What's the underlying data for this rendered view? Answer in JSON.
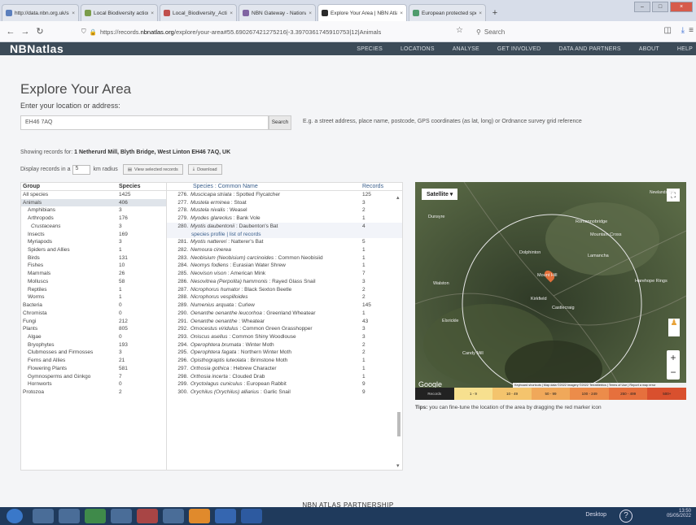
{
  "browser": {
    "tabs": [
      {
        "label": "http://data.nbn.org.uk/sites/r",
        "color": "#5b7fbd"
      },
      {
        "label": "Local Biodiversity action plan |",
        "color": "#7a9c4a"
      },
      {
        "label": "Local_Biodiversity_Action_Plan_2",
        "color": "#c0504d"
      },
      {
        "label": "NBN Gateway - National Biodi",
        "color": "#8064a2"
      },
      {
        "label": "Explore Your Area | NBN Atlas",
        "color": "#2b2b2b"
      },
      {
        "label": "European protected species | N",
        "color": "#4f9c6d"
      }
    ],
    "url_prefix": "https://records.",
    "url_domain": "nbnatlas.org",
    "url_rest": "/explore/your-area#55.690267421275216|-3.3970361745910753|12|Animals",
    "search_placeholder": "Search"
  },
  "site": {
    "logo": "NBNatlas",
    "nav": [
      "SPECIES",
      "LOCATIONS",
      "ANALYSE",
      "GET INVOLVED",
      "DATA AND PARTNERS",
      "ABOUT",
      "HELP"
    ],
    "page_title": "Explore Your Area",
    "location_prompt": "Enter your location or address:",
    "location_value": "EH46 7AQ",
    "search_button": "Search",
    "hint": "E.g. a street address, place name, postcode, GPS coordinates (as lat, long) or Ordnance survey grid reference",
    "showing_prefix": "Showing records for:",
    "showing_place": "1 Netherurd Mill, Blyth Bridge, West Linton EH46 7AQ, UK",
    "display_prefix": "Display records in a",
    "radius": "5",
    "display_suffix": "km radius",
    "view_btn": "View selected records",
    "download_btn": "Download",
    "tips_bold": "Tips:",
    "tips_text": "you can fine-tune the location of the area by dragging the red marker icon",
    "partnership": "NBN ATLAS PARTNERSHIP"
  },
  "groups": {
    "headers": [
      "Group",
      "Species"
    ],
    "rows": [
      {
        "name": "All species",
        "count": "1425",
        "level": 0
      },
      {
        "name": "Animals",
        "count": "406",
        "level": 0,
        "selected": true
      },
      {
        "name": "Amphibians",
        "count": "3",
        "level": 1
      },
      {
        "name": "Arthropods",
        "count": "176",
        "level": 1
      },
      {
        "name": "Crustaceans",
        "count": "3",
        "level": 2
      },
      {
        "name": "Insects",
        "count": "169",
        "level": 1
      },
      {
        "name": "Myriapods",
        "count": "3",
        "level": 1
      },
      {
        "name": "Spiders and Allies",
        "count": "1",
        "level": 1
      },
      {
        "name": "Birds",
        "count": "131",
        "level": 1
      },
      {
        "name": "Fishes",
        "count": "10",
        "level": 1
      },
      {
        "name": "Mammals",
        "count": "26",
        "level": 1
      },
      {
        "name": "Molluscs",
        "count": "58",
        "level": 1
      },
      {
        "name": "Reptiles",
        "count": "1",
        "level": 1
      },
      {
        "name": "Worms",
        "count": "1",
        "level": 1
      },
      {
        "name": "Bacteria",
        "count": "0",
        "level": 0
      },
      {
        "name": "Chromista",
        "count": "0",
        "level": 0
      },
      {
        "name": "Fungi",
        "count": "212",
        "level": 0
      },
      {
        "name": "Plants",
        "count": "805",
        "level": 0
      },
      {
        "name": "Algae",
        "count": "0",
        "level": 1
      },
      {
        "name": "Bryophytes",
        "count": "193",
        "level": 1
      },
      {
        "name": "Clubmosses and Firmosses",
        "count": "3",
        "level": 1
      },
      {
        "name": "Ferns and Allies",
        "count": "21",
        "level": 1
      },
      {
        "name": "Flowering Plants",
        "count": "581",
        "level": 1
      },
      {
        "name": "Gymnosperms and Ginkgo",
        "count": "7",
        "level": 1
      },
      {
        "name": "Hornworts",
        "count": "0",
        "level": 1
      },
      {
        "name": "Protozoa",
        "count": "2",
        "level": 0
      }
    ]
  },
  "species": {
    "headers": [
      "Species : Common Name",
      "Records"
    ],
    "profile_link": "species profile",
    "records_link": "list of records",
    "rows": [
      {
        "n": "276.",
        "sci": "Muscicapa striata",
        "common": "Spotted Flycatcher",
        "rec": "125"
      },
      {
        "n": "277.",
        "sci": "Mustela erminea",
        "common": "Stoat",
        "rec": "3"
      },
      {
        "n": "278.",
        "sci": "Mustela nivalis",
        "common": "Weasel",
        "rec": "2"
      },
      {
        "n": "279.",
        "sci": "Myodes glareolus",
        "common": "Bank Vole",
        "rec": "1"
      },
      {
        "n": "280.",
        "sci": "Myotis daubentonii",
        "common": "Daubenton's Bat",
        "rec": "4",
        "expanded": true
      },
      {
        "n": "281.",
        "sci": "Myotis nattereri",
        "common": "Natterer's Bat",
        "rec": "5"
      },
      {
        "n": "282.",
        "sci": "Nemoura cinerea",
        "common": "",
        "rec": "1"
      },
      {
        "n": "283.",
        "sci": "Neobisium (Neobisium) carcinoides",
        "common": "Common Neobisiid",
        "rec": "1"
      },
      {
        "n": "284.",
        "sci": "Neomys fodiens",
        "common": "Eurasian Water Shrew",
        "rec": "1"
      },
      {
        "n": "285.",
        "sci": "Neovison vison",
        "common": "American Mink",
        "rec": "7"
      },
      {
        "n": "286.",
        "sci": "Nesovitrea (Perpolita) hammonis",
        "common": "Rayed Glass Snail",
        "rec": "3"
      },
      {
        "n": "287.",
        "sci": "Nicrophorus humator",
        "common": "Black Sexton Beetle",
        "rec": "2"
      },
      {
        "n": "288.",
        "sci": "Nicrophorus vespilloides",
        "common": "",
        "rec": "2"
      },
      {
        "n": "289.",
        "sci": "Numenius arquata",
        "common": "Curlew",
        "rec": "145"
      },
      {
        "n": "290.",
        "sci": "Oenanthe oenanthe leucorhoa",
        "common": "Greenland Wheatear",
        "rec": "1"
      },
      {
        "n": "291.",
        "sci": "Oenanthe oenanthe",
        "common": "Wheatear",
        "rec": "43"
      },
      {
        "n": "292.",
        "sci": "Omocestus viridulus",
        "common": "Common Green Grasshopper",
        "rec": "3"
      },
      {
        "n": "293.",
        "sci": "Oniscus asellus",
        "common": "Common Shiny Woodlouse",
        "rec": "3"
      },
      {
        "n": "294.",
        "sci": "Operophtera brumata",
        "common": "Winter Moth",
        "rec": "2"
      },
      {
        "n": "295.",
        "sci": "Operophtera fagata",
        "common": "Northern Winter Moth",
        "rec": "2"
      },
      {
        "n": "296.",
        "sci": "Opisthograptis luteolata",
        "common": "Brimstone Moth",
        "rec": "1"
      },
      {
        "n": "297.",
        "sci": "Orthosia gothica",
        "common": "Hebrew Character",
        "rec": "1"
      },
      {
        "n": "298.",
        "sci": "Orthosia incerta",
        "common": "Clouded Drab",
        "rec": "1"
      },
      {
        "n": "299.",
        "sci": "Oryctolagus cuniculus",
        "common": "European Rabbit",
        "rec": "9"
      },
      {
        "n": "300.",
        "sci": "Orychilus (Orychilus) alliarius",
        "common": "Garlic Snail",
        "rec": "9"
      }
    ]
  },
  "map": {
    "type_button": "Satellite",
    "labels": [
      "Dunsyre",
      "Walston",
      "Dolphinton",
      "Kirkfield",
      "Elsrickle",
      "Castlecraig",
      "Mountain Cross",
      "Lamancha",
      "Romannobridge",
      "Candy Mill",
      "Newlands Hill",
      "Harehope Rings",
      "Mount Hill"
    ],
    "google": "Google",
    "attribution": "Keyboard shortcuts | Map data ©2022 Imagery ©2022 TerraMetrics | Terms of Use | Report a map error",
    "legend_label": "Records",
    "legend": [
      {
        "label": "1 - 9",
        "color": "#f7e08f"
      },
      {
        "label": "10 - 49",
        "color": "#f4c46d"
      },
      {
        "label": "50 - 99",
        "color": "#f0a85a"
      },
      {
        "label": "100 - 249",
        "color": "#ec8c4a"
      },
      {
        "label": "250 - 499",
        "color": "#e6703d"
      },
      {
        "label": "500+",
        "color": "#d9502e"
      }
    ],
    "zoom_in": "+",
    "zoom_out": "−"
  },
  "taskbar": {
    "desktop_label": "Desktop",
    "time": "13:50",
    "date": "05/05/2022"
  },
  "colors": {
    "accent": "#3a5f8c",
    "header": "#3c4b58",
    "marker": "#e2703a"
  }
}
